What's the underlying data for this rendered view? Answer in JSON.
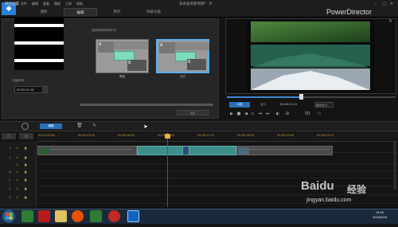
{
  "app": {
    "menu": [
      "文件",
      "编辑",
      "查看",
      "播放",
      "工具",
      "帮助"
    ],
    "modes": [
      "捕获",
      "编辑",
      "制作",
      "刻录光盘"
    ],
    "active_mode": "编辑",
    "doc_title": "未命名的新项目*",
    "brand": "PowerDirector",
    "window_controls": [
      "–",
      "□",
      "✕"
    ]
  },
  "transition_panel": {
    "title": "转场设置",
    "duration_label": "持续时间",
    "duration_value": "00:00:01:18",
    "options_label": "选择转场的转场行为",
    "options": [
      {
        "caption": "覆盖",
        "a": "A",
        "b": "B",
        "selected": false
      },
      {
        "caption": "交叉",
        "a": "A",
        "b": "B",
        "selected": true
      }
    ],
    "apply_label": "应用"
  },
  "preview": {
    "clip_tab": "片段",
    "movie_tab": "影片",
    "timecode": "00:00:01:01",
    "zoom": "适合大小",
    "progress": 0.44,
    "controls": [
      "▶",
      "■",
      "◀",
      "▷",
      "⏮",
      "⏭",
      "◐",
      "⊞",
      "3D",
      "▭"
    ]
  },
  "toolbar": {
    "edit_label": "编辑"
  },
  "timeline": {
    "head_a": "□",
    "head_b": "◫",
    "ticks": [
      "00:00:00:00",
      "00:00:03:10",
      "00:00:06:20",
      "00:00:10:00",
      "00:00:13:10",
      "00:00:16:20",
      "00:00:20:00",
      "00:00:23:10"
    ],
    "tracks": [
      "1.",
      "1.",
      "",
      "fx",
      "2.",
      "2.",
      "3."
    ],
    "clip1_name": "IMG_0001",
    "clip2_name": "IMG_0002"
  },
  "taskbar": {
    "time": "19:40",
    "date": "2019/4/16"
  },
  "watermark": {
    "brand": "Baidu",
    "cn": "经验",
    "url": "jingyan.baidu.com"
  },
  "colors": {
    "accent": "#2a6fb8",
    "selected_border": "#5ab1f2",
    "transition": "#3d8f8a",
    "playhead": "#d02020"
  }
}
